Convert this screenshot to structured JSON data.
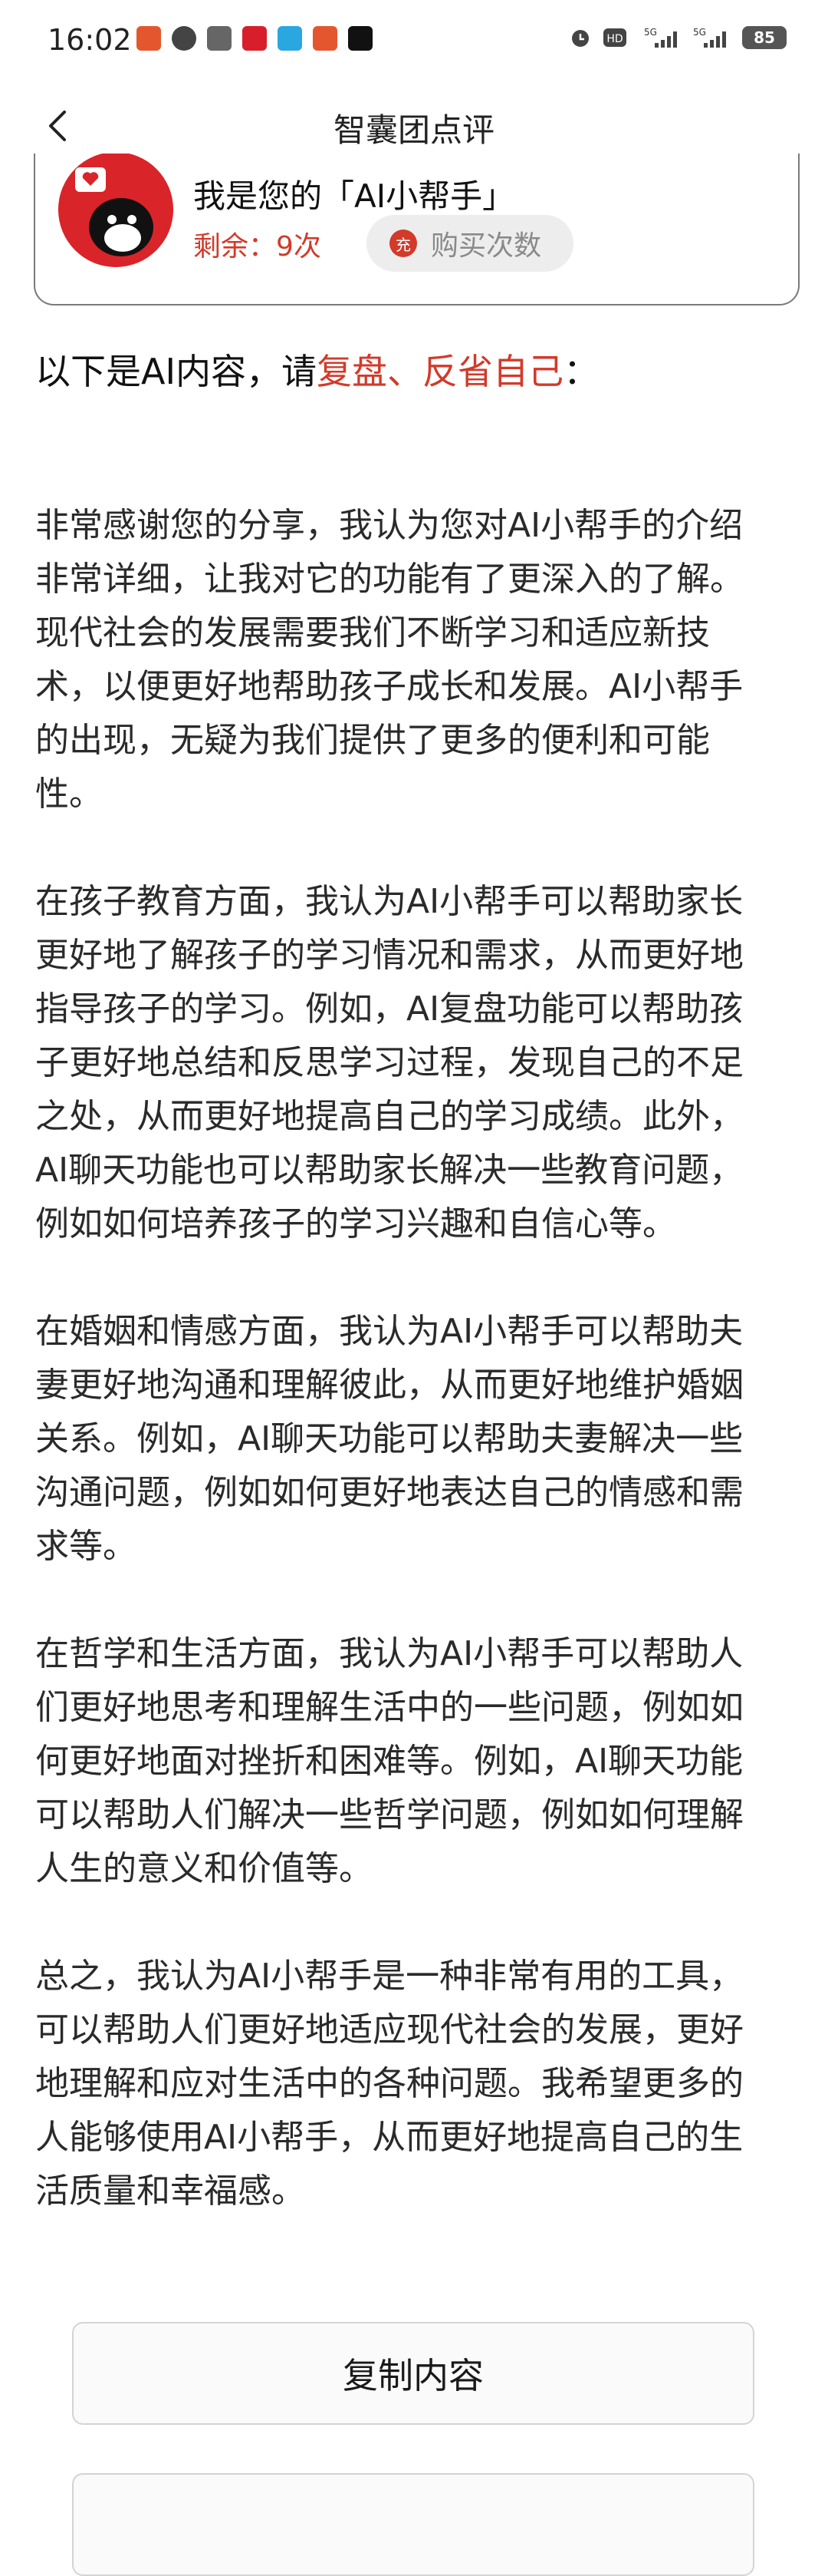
{
  "status_bar": {
    "time": "16:02",
    "battery": "85",
    "icons": [
      "alarm-icon",
      "hd-icon",
      "signal-5g-icon",
      "signal-5g-icon",
      "battery-icon"
    ],
    "network_1": "5G",
    "network_2": "5G",
    "hd": "HD"
  },
  "header": {
    "title": "智囊团点评",
    "back_icon": "back-arrow-icon"
  },
  "card": {
    "helper_text": "我是您的「AI小帮手」",
    "remaining": "剩余：9次",
    "coin_char": "充",
    "buy_label": "购买次数"
  },
  "intro": {
    "prefix": "以下是AI内容，请",
    "highlight": "复盘、反省自己",
    "suffix": "："
  },
  "paragraphs": [
    "非常感谢您的分享，我认为您对AI小帮手的介绍非常详细，让我对它的功能有了更深入的了解。现代社会的发展需要我们不断学习和适应新技术，以便更好地帮助孩子成长和发展。AI小帮手的出现，无疑为我们提供了更多的便利和可能性。",
    "在孩子教育方面，我认为AI小帮手可以帮助家长更好地了解孩子的学习情况和需求，从而更好地指导孩子的学习。例如，AI复盘功能可以帮助孩子更好地总结和反思学习过程，发现自己的不足之处，从而更好地提高自己的学习成绩。此外，AI聊天功能也可以帮助家长解决一些教育问题，例如如何培养孩子的学习兴趣和自信心等。",
    "在婚姻和情感方面，我认为AI小帮手可以帮助夫妻更好地沟通和理解彼此，从而更好地维护婚姻关系。例如，AI聊天功能可以帮助夫妻解决一些沟通问题，例如如何更好地表达自己的情感和需求等。",
    "在哲学和生活方面，我认为AI小帮手可以帮助人们更好地思考和理解生活中的一些问题，例如如何更好地面对挫折和困难等。例如，AI聊天功能可以帮助人们解决一些哲学问题，例如如何理解人生的意义和价值等。",
    "总之，我认为AI小帮手是一种非常有用的工具，可以帮助人们更好地适应现代社会的发展，更好地理解和应对生活中的各种问题。我希望更多的人能够使用AI小帮手，从而更好地提高自己的生活质量和幸福感。"
  ],
  "buttons": {
    "copy": "复制内容"
  },
  "colors": {
    "accent": "#d23a2a",
    "text": "#2a2a2a"
  }
}
